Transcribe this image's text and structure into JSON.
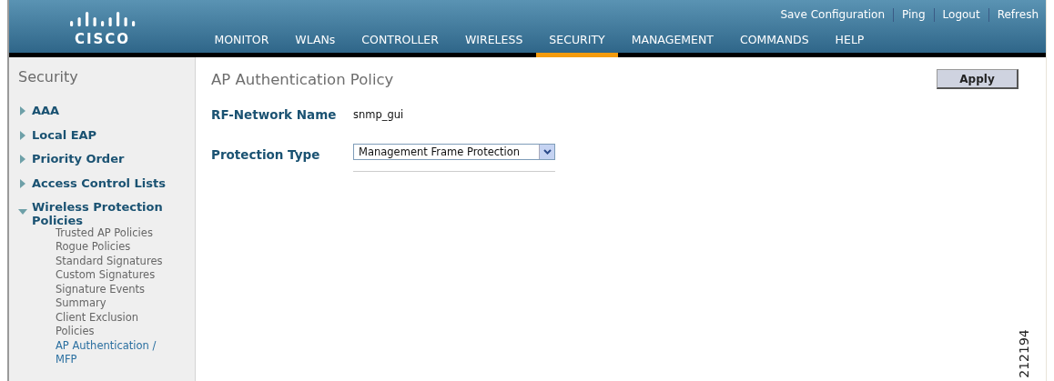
{
  "header": {
    "logo": "CISCO",
    "links": [
      {
        "label": "Save Configuration"
      },
      {
        "label": "Ping"
      },
      {
        "label": "Logout"
      },
      {
        "label": "Refresh"
      }
    ],
    "menu": [
      {
        "label": "MONITOR",
        "selected": false
      },
      {
        "label": "WLANs",
        "selected": false
      },
      {
        "label": "CONTROLLER",
        "selected": false
      },
      {
        "label": "WIRELESS",
        "selected": false
      },
      {
        "label": "SECURITY",
        "selected": true
      },
      {
        "label": "MANAGEMENT",
        "selected": false
      },
      {
        "label": "COMMANDS",
        "selected": false
      },
      {
        "label": "HELP",
        "selected": false
      }
    ]
  },
  "sidebar": {
    "title": "Security",
    "items": [
      {
        "label": "AAA",
        "expanded": false
      },
      {
        "label": "Local EAP",
        "expanded": false
      },
      {
        "label": "Priority Order",
        "expanded": false
      },
      {
        "label": "Access Control Lists",
        "expanded": false
      },
      {
        "label": "Wireless Protection Policies",
        "expanded": true,
        "children": [
          {
            "label": "Trusted AP Policies",
            "selected": false
          },
          {
            "label": "Rogue Policies",
            "selected": false
          },
          {
            "label": "Standard Signatures",
            "selected": false
          },
          {
            "label": "Custom Signatures",
            "selected": false
          },
          {
            "label": "Signature Events Summary",
            "selected": false
          },
          {
            "label": "Client Exclusion Policies",
            "selected": false
          },
          {
            "label": "AP Authentication / MFP",
            "selected": true
          }
        ]
      }
    ]
  },
  "content": {
    "title": "AP Authentication Policy",
    "apply_button": "Apply",
    "fields": [
      {
        "kind": "text",
        "label": "RF-Network Name",
        "value": "snmp_gui"
      },
      {
        "kind": "dropdown",
        "label": "Protection Type",
        "value": "Management Frame Protection"
      }
    ]
  },
  "figure_id": "212194"
}
